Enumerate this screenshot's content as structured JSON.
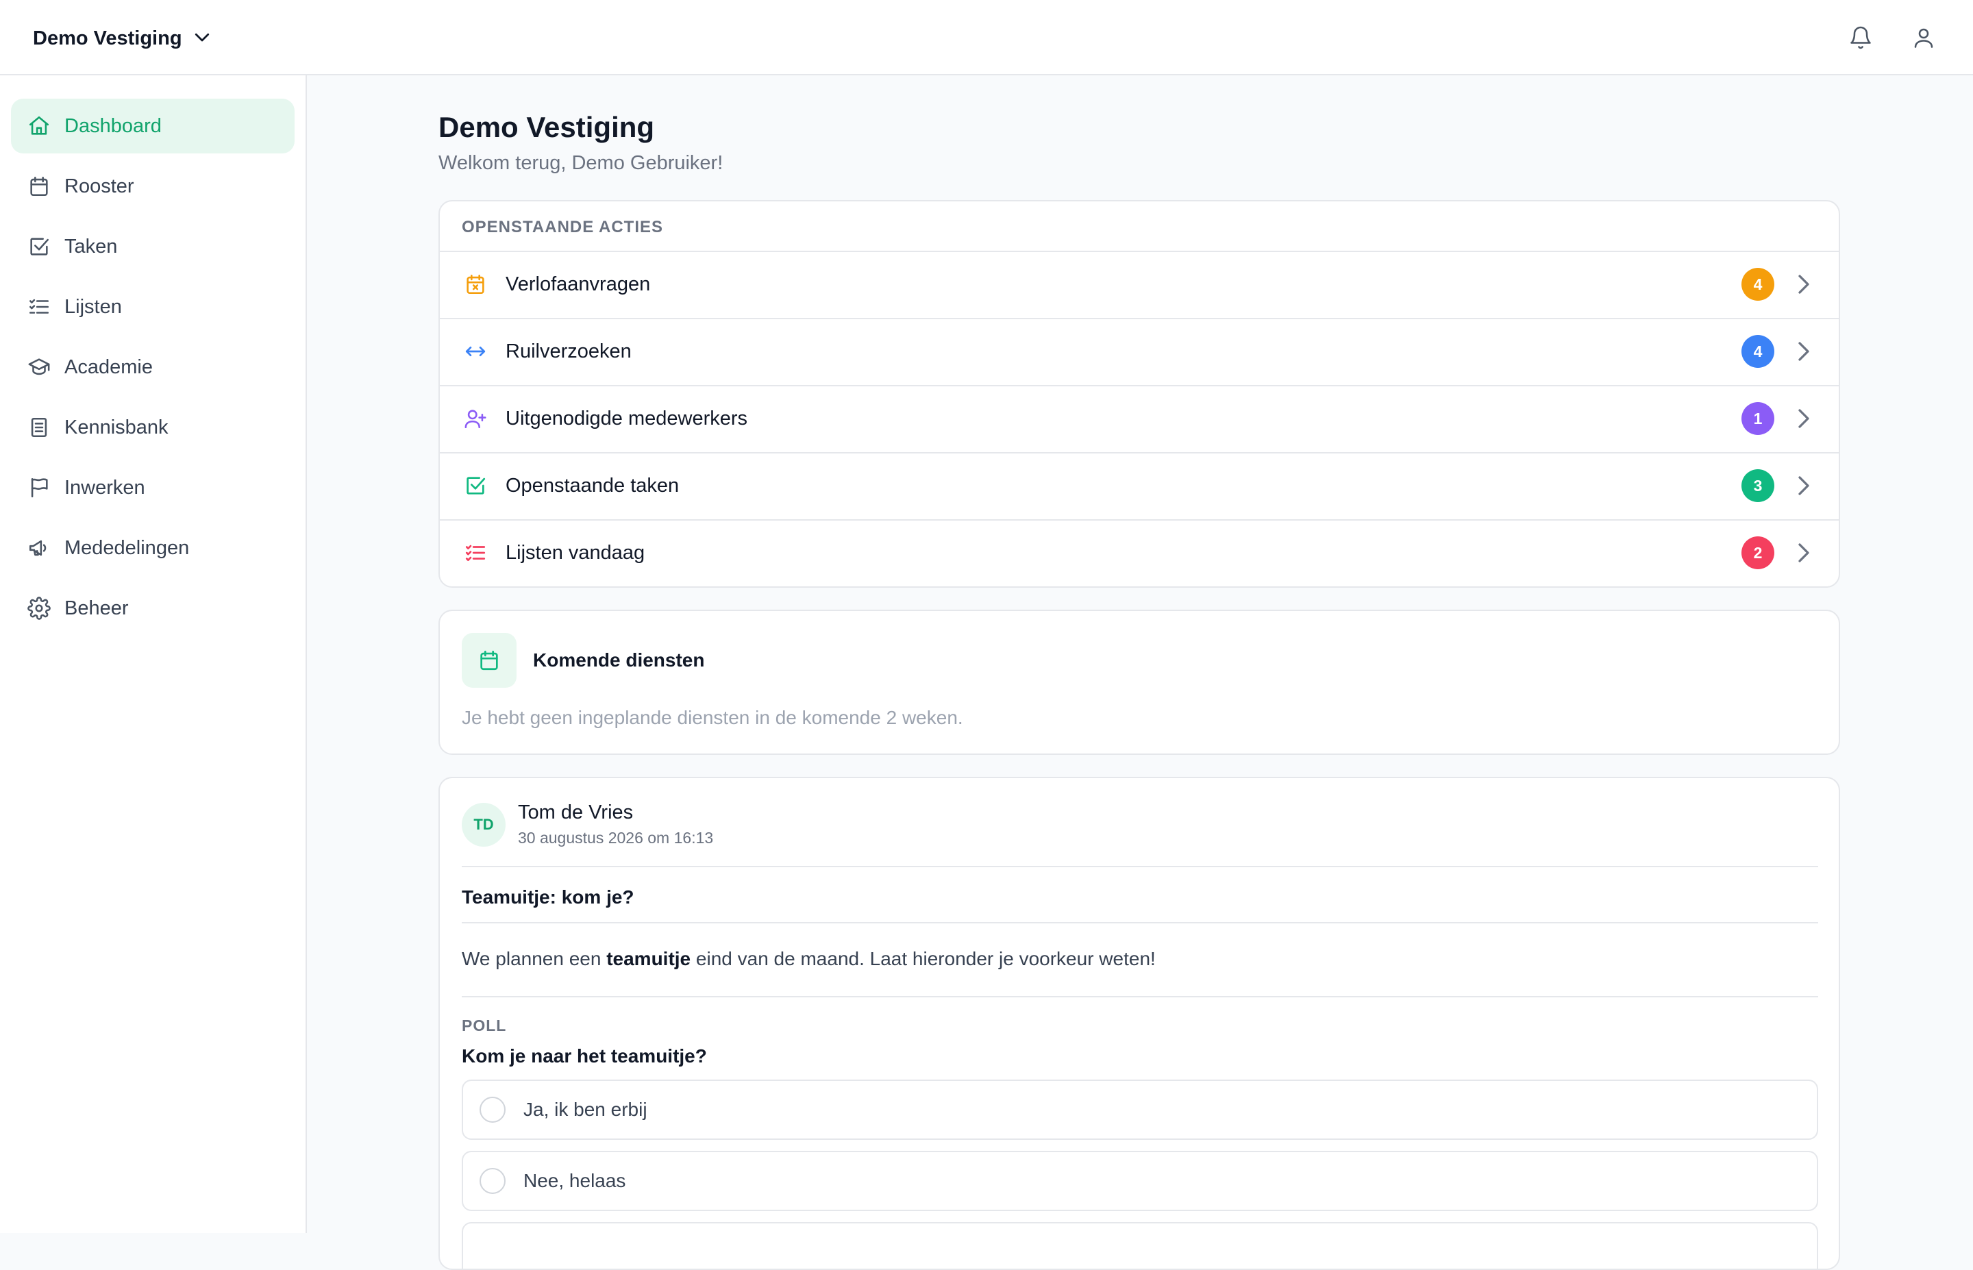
{
  "header": {
    "branch_name": "Demo Vestiging"
  },
  "sidebar": {
    "items": [
      {
        "label": "Dashboard",
        "icon": "home-icon",
        "active": true
      },
      {
        "label": "Rooster",
        "icon": "calendar-icon"
      },
      {
        "label": "Taken",
        "icon": "checkbox-icon"
      },
      {
        "label": "Lijsten",
        "icon": "list-icon"
      },
      {
        "label": "Academie",
        "icon": "graduation-cap-icon"
      },
      {
        "label": "Kennisbank",
        "icon": "document-icon"
      },
      {
        "label": "Inwerken",
        "icon": "flag-icon"
      },
      {
        "label": "Mededelingen",
        "icon": "megaphone-icon"
      },
      {
        "label": "Beheer",
        "icon": "gear-icon"
      }
    ]
  },
  "main": {
    "title": "Demo Vestiging",
    "subtitle": "Welkom terug, Demo Gebruiker!"
  },
  "actions": {
    "heading": "OPENSTAANDE ACTIES",
    "items": [
      {
        "label": "Verlofaanvragen",
        "count": "4",
        "color": "#f59e0b",
        "icon": "calendar-x-icon"
      },
      {
        "label": "Ruilverzoeken",
        "count": "4",
        "color": "#3b82f6",
        "icon": "swap-arrows-icon"
      },
      {
        "label": "Uitgenodigde medewerkers",
        "count": "1",
        "color": "#8b5cf6",
        "icon": "user-plus-icon"
      },
      {
        "label": "Openstaande taken",
        "count": "3",
        "color": "#10b981",
        "icon": "checkbox-icon"
      },
      {
        "label": "Lijsten vandaag",
        "count": "2",
        "color": "#f43f5e",
        "icon": "checklist-icon"
      }
    ]
  },
  "shifts": {
    "title": "Komende diensten",
    "empty_text": "Je hebt geen ingeplande diensten in de komende 2 weken."
  },
  "post": {
    "initials": "TD",
    "author": "Tom de Vries",
    "date": "30 augustus 2026 om 16:13",
    "title": "Teamuitje: kom je?",
    "body_before": "We plannen een ",
    "body_bold": "teamuitje",
    "body_after": " eind van de maand. Laat hieronder je voorkeur weten!",
    "poll_label": "POLL",
    "poll_question": "Kom je naar het teamuitje?",
    "poll_options": [
      "Ja, ik ben erbij",
      "Nee, helaas"
    ]
  },
  "colors": {
    "brand_green": "#10a36b",
    "brand_green_bg": "#e6f7ef"
  }
}
